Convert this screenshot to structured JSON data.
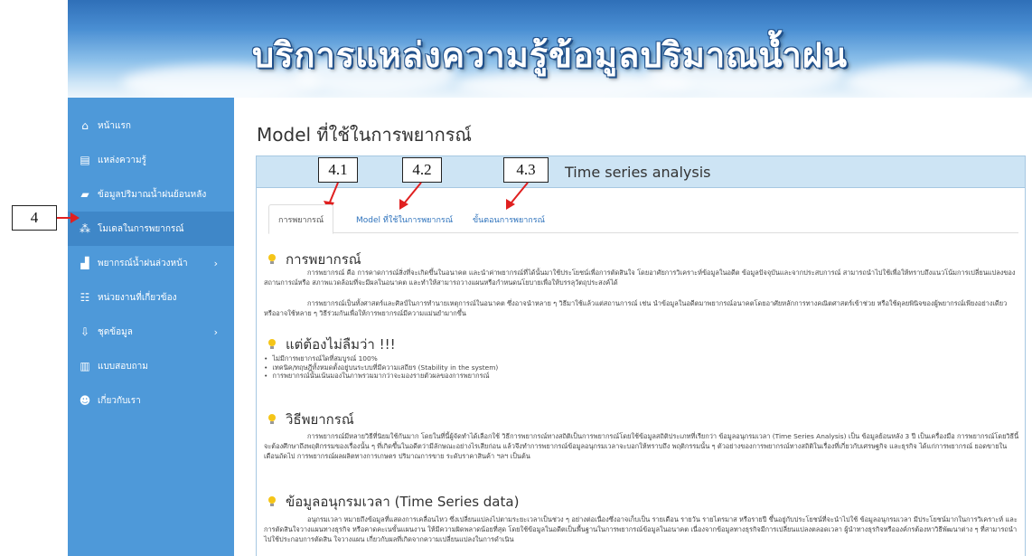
{
  "header": {
    "title": "บริการแหล่งความรู้ข้อมูลปริมาณน้ำฝน"
  },
  "sidebar": {
    "items": [
      {
        "label": "หน้าแรก",
        "icon": "home-icon",
        "glyph": "⌂"
      },
      {
        "label": "แหล่งความรู้",
        "icon": "book-icon",
        "glyph": "▤"
      },
      {
        "label": "ข้อมูลปริมาณน้ำฝนย้อนหลัง",
        "icon": "folder-icon",
        "glyph": "▰"
      },
      {
        "label": "โมเดลในการพยากรณ์",
        "icon": "sitemap-icon",
        "glyph": "⁂"
      },
      {
        "label": "พยากรณ์น้ำฝนล่วงหน้า",
        "icon": "bar-chart-icon",
        "glyph": "▟"
      },
      {
        "label": "หน่วยงานที่เกี่ยวข้อง",
        "icon": "users-icon",
        "glyph": "☷"
      },
      {
        "label": "ชุดข้อมูล",
        "icon": "download-icon",
        "glyph": "⇩"
      },
      {
        "label": "แบบสอบถาม",
        "icon": "form-icon",
        "glyph": "▥"
      },
      {
        "label": "เกี่ยวกับเรา",
        "icon": "user-info-icon",
        "glyph": "☻"
      }
    ],
    "chevron": "›"
  },
  "annotations": {
    "a4": "4",
    "a41": "4.1",
    "a42": "4.2",
    "a43": "4.3",
    "arrow_color": "#e02020"
  },
  "main": {
    "page_title": "Model ที่ใช้ในการพยากรณ์",
    "panel_title": "Time series analysis",
    "tabs": [
      {
        "label": "การพยากรณ์"
      },
      {
        "label": "Model ที่ใช้ในการพยากรณ์"
      },
      {
        "label": "ขั้นตอนการพยากรณ์"
      }
    ],
    "sections": {
      "s1": {
        "title": "การพยากรณ์",
        "p1": "การพยากรณ์ คือ การคาดการณ์สิ่งที่จะเกิดขึ้นในอนาคต และนำค่าพยากรณ์ที่ได้นั้นมาใช้ประโยชน์เพื่อการตัดสินใจ โดยอาศัยการวิเคราะห์ข้อมูลในอดีต ข้อมูลปัจจุบันและจากประสบการณ์ สามารถนำไปใช้เพื่อให้ทราบถึงแนวโน้มการเปลี่ยนแปลงของสถานการณ์หรือ สภาพแวดล้อมที่จะมีผลในอนาคต และทำให้สามารถวางแผนหรือกำหนดนโยบายเพื่อให้บรรลุวัตถุประสงค์ได้",
        "p2": "การพยากรณ์เป็นทั้งศาสตร์และศิลป์ในการทำนายเหตุการณ์ในอนาคต ซึ่งอาจนำหลาย ๆ วิธีมาใช้แล้วแต่สถานการณ์ เช่น นำข้อมูลในอดีตมาพยากรณ์อนาคตโดยอาศัยหลักการทางคณิตศาสตร์เข้าช่วย หรือใช้ดุลยพินิจของผู้พยากรณ์เพียงอย่างเดียว หรืออาจใช้หลาย ๆ วิธีร่วมกันเพื่อให้การพยากรณ์มีความแม่นยำมากขึ้น"
      },
      "s2": {
        "title": "แต่ต้องไม่ลืมว่า !!!",
        "bullets": [
          "ไม่มีการพยากรณ์ใดที่สมบูรณ์ 100%",
          "เทคนิค/ทฤษฎีทั้งหมดตั้งอยู่บนระบบที่มีความเสถียร (Stability in the system)",
          "การพยากรณ์นั้นเน้นมองในภาพรวมมากว่าจะมองรายตัวผลของการพยากรณ์"
        ]
      },
      "s3": {
        "title": "วิธีพยากรณ์",
        "p1": "การพยากรณ์มีหลายวิธีที่นิยมใช้กันมาก โดยในที่นี้ผู้จัดทำได้เลือกใช้ วิธีการพยากรณ์ทางสถิติเป็นการพยากรณ์โดยใช้ข้อมูลสถิติประเภทที่เรียกว่า ข้อมูลอนุกรมเวลา (Time Series Analysis) เป็น ข้อมูลย้อนหลัง 3 ปี เป็นเครื่องมือ การพยากรณ์โดยวิธีนี้จะต้องศึกษาถึงพฤติกรรมของเรื่องนั้น ๆ ที่เกิดขึ้นในอดีตว่ามีลักษณะอย่างไรเสียก่อน แล้วจึงทำการพยากรณ์ข้อมูลอนุกรมเวลาจะบอกให้ทราบถึง พฤติกรรมนั้น ๆ ตัวอย่างของการพยากรณ์ทางสถิติในเรื่องที่เกี่ยวกับเศรษฐกิจ และธุรกิจ ได้แก่การพยากรณ์ ยอดขายในเดือนถัดไป การพยากรณ์ผลผลิตทางการเกษตร ปริมาณการขาย ระดับราคาสินค้า ฯลฯ เป็นต้น"
      },
      "s4": {
        "title": "ข้อมูลอนุกรมเวลา (Time Series data)",
        "p1": "อนุกรมเวลา หมายถึงข้อมูลที่แสดงการเคลื่อนไหว ซึ่งเปลี่ยนแปลงไปตามระยะเวลาเป็นช่วง ๆ อย่างต่อเนื่องซึ่งอาจเก็บเป็น รายเดือน รายวัน รายไตรมาส หรือรายปี ขึ้นอยู่กับประโยชน์ที่จะนำไปใช้ ข้อมูลอนุกรมเวลา มีประโยชน์มากในการวิเคราะห์ และการตัดสินใจวางแผนทางธุรกิจ หรือคาดคะเนขั้นแผนงาน ให้มีความผิดพลาดน้อยที่สุด โดยใช้ข้อมูลในอดีตเป็นพื้นฐานในการพยากรณ์ข้อมูลในอนาคต เนื่องจากข้อมูลทางธุรกิจมีการเปลี่ยนแปลงตลอดเวลา ผู้นำทางธุรกิจหรือองค์กรต้องหาวิธีพัฒนาต่าง ๆ ที่สามารถนำไปใช้ประกอบการตัดสิน ใจวางแผน เกี่ยวกับผลที่เกิดจากความเปลี่ยนแปลงในการดำเนิน"
      }
    }
  }
}
